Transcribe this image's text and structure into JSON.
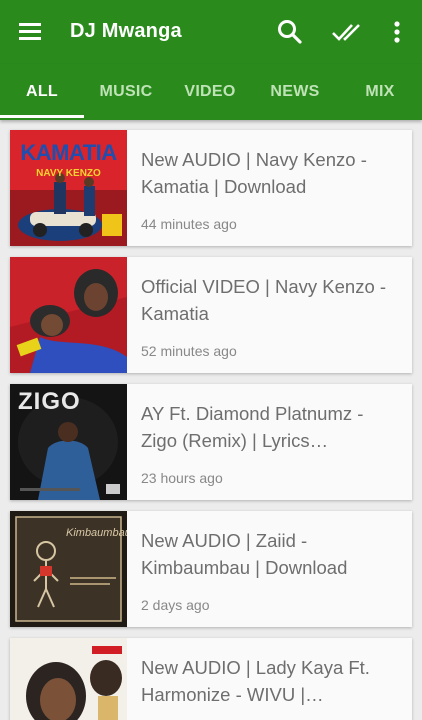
{
  "app": {
    "title": "DJ Mwanga"
  },
  "colors": {
    "brand": "#2a8a1c",
    "tab_inactive": "#bfe3b6",
    "card_bg": "#fafafa",
    "title_text": "#6e6e6e"
  },
  "toolbar": {
    "menu_icon": "hamburger-menu-icon",
    "search_icon": "search-icon",
    "mark_read_icon": "double-check-icon",
    "more_icon": "more-vertical-icon"
  },
  "tabs": [
    {
      "label": "ALL",
      "active": true
    },
    {
      "label": "MUSIC",
      "active": false
    },
    {
      "label": "VIDEO",
      "active": false
    },
    {
      "label": "NEWS",
      "active": false
    },
    {
      "label": "MIX",
      "active": false
    }
  ],
  "posts": [
    {
      "title": "New AUDIO | Navy Kenzo - Kamatia | Download",
      "time": "44 minutes ago",
      "thumb_text": "KAMATIA",
      "thumb_sub": "NAVY KENZO"
    },
    {
      "title": "Official VIDEO | Navy Kenzo - Kamatia",
      "time": "52 minutes ago"
    },
    {
      "title": "AY Ft. Diamond Platnumz - Zigo (Remix) | Lyrics…",
      "time": "23 hours ago",
      "thumb_text": "ZIGO"
    },
    {
      "title": "New AUDIO | Zaiid - Kimbaumbau | Download",
      "time": "2 days ago",
      "thumb_text": "Kimbaumbau"
    },
    {
      "title": "New AUDIO | Lady Kaya Ft. Harmonize - WIVU |…",
      "time": ""
    }
  ]
}
